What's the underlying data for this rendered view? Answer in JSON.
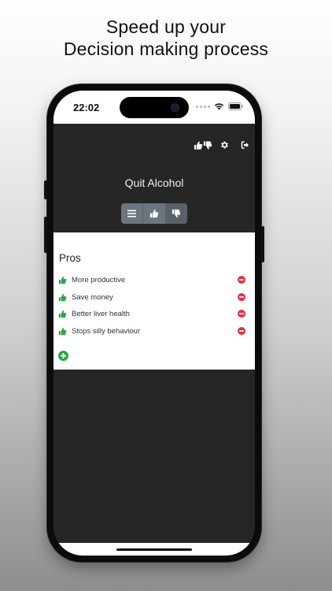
{
  "headline": {
    "line1": "Speed up your",
    "line2": "Decision making process"
  },
  "status_bar": {
    "time": "22:02",
    "icons": [
      "cellular-icon",
      "wifi-icon",
      "battery-icon"
    ]
  },
  "toolbar": {
    "icons": [
      "pros-cons-icon",
      "gear-icon",
      "sign-out-icon"
    ]
  },
  "decision": {
    "title": "Quit Alcohol"
  },
  "view_switch": {
    "buttons": [
      "list-icon",
      "thumbs-up-icon",
      "thumbs-down-icon"
    ],
    "active": "thumbs-down-icon"
  },
  "pros": {
    "heading": "Pros",
    "items": [
      {
        "label": "More productive"
      },
      {
        "label": "Save money"
      },
      {
        "label": "Better liver health"
      },
      {
        "label": "Stops silly behaviour"
      }
    ]
  },
  "colors": {
    "dark_bg": "#262626",
    "thumb_green": "#28a745",
    "remove_red": "#dc3545",
    "segment_gray": "#6c757d"
  }
}
